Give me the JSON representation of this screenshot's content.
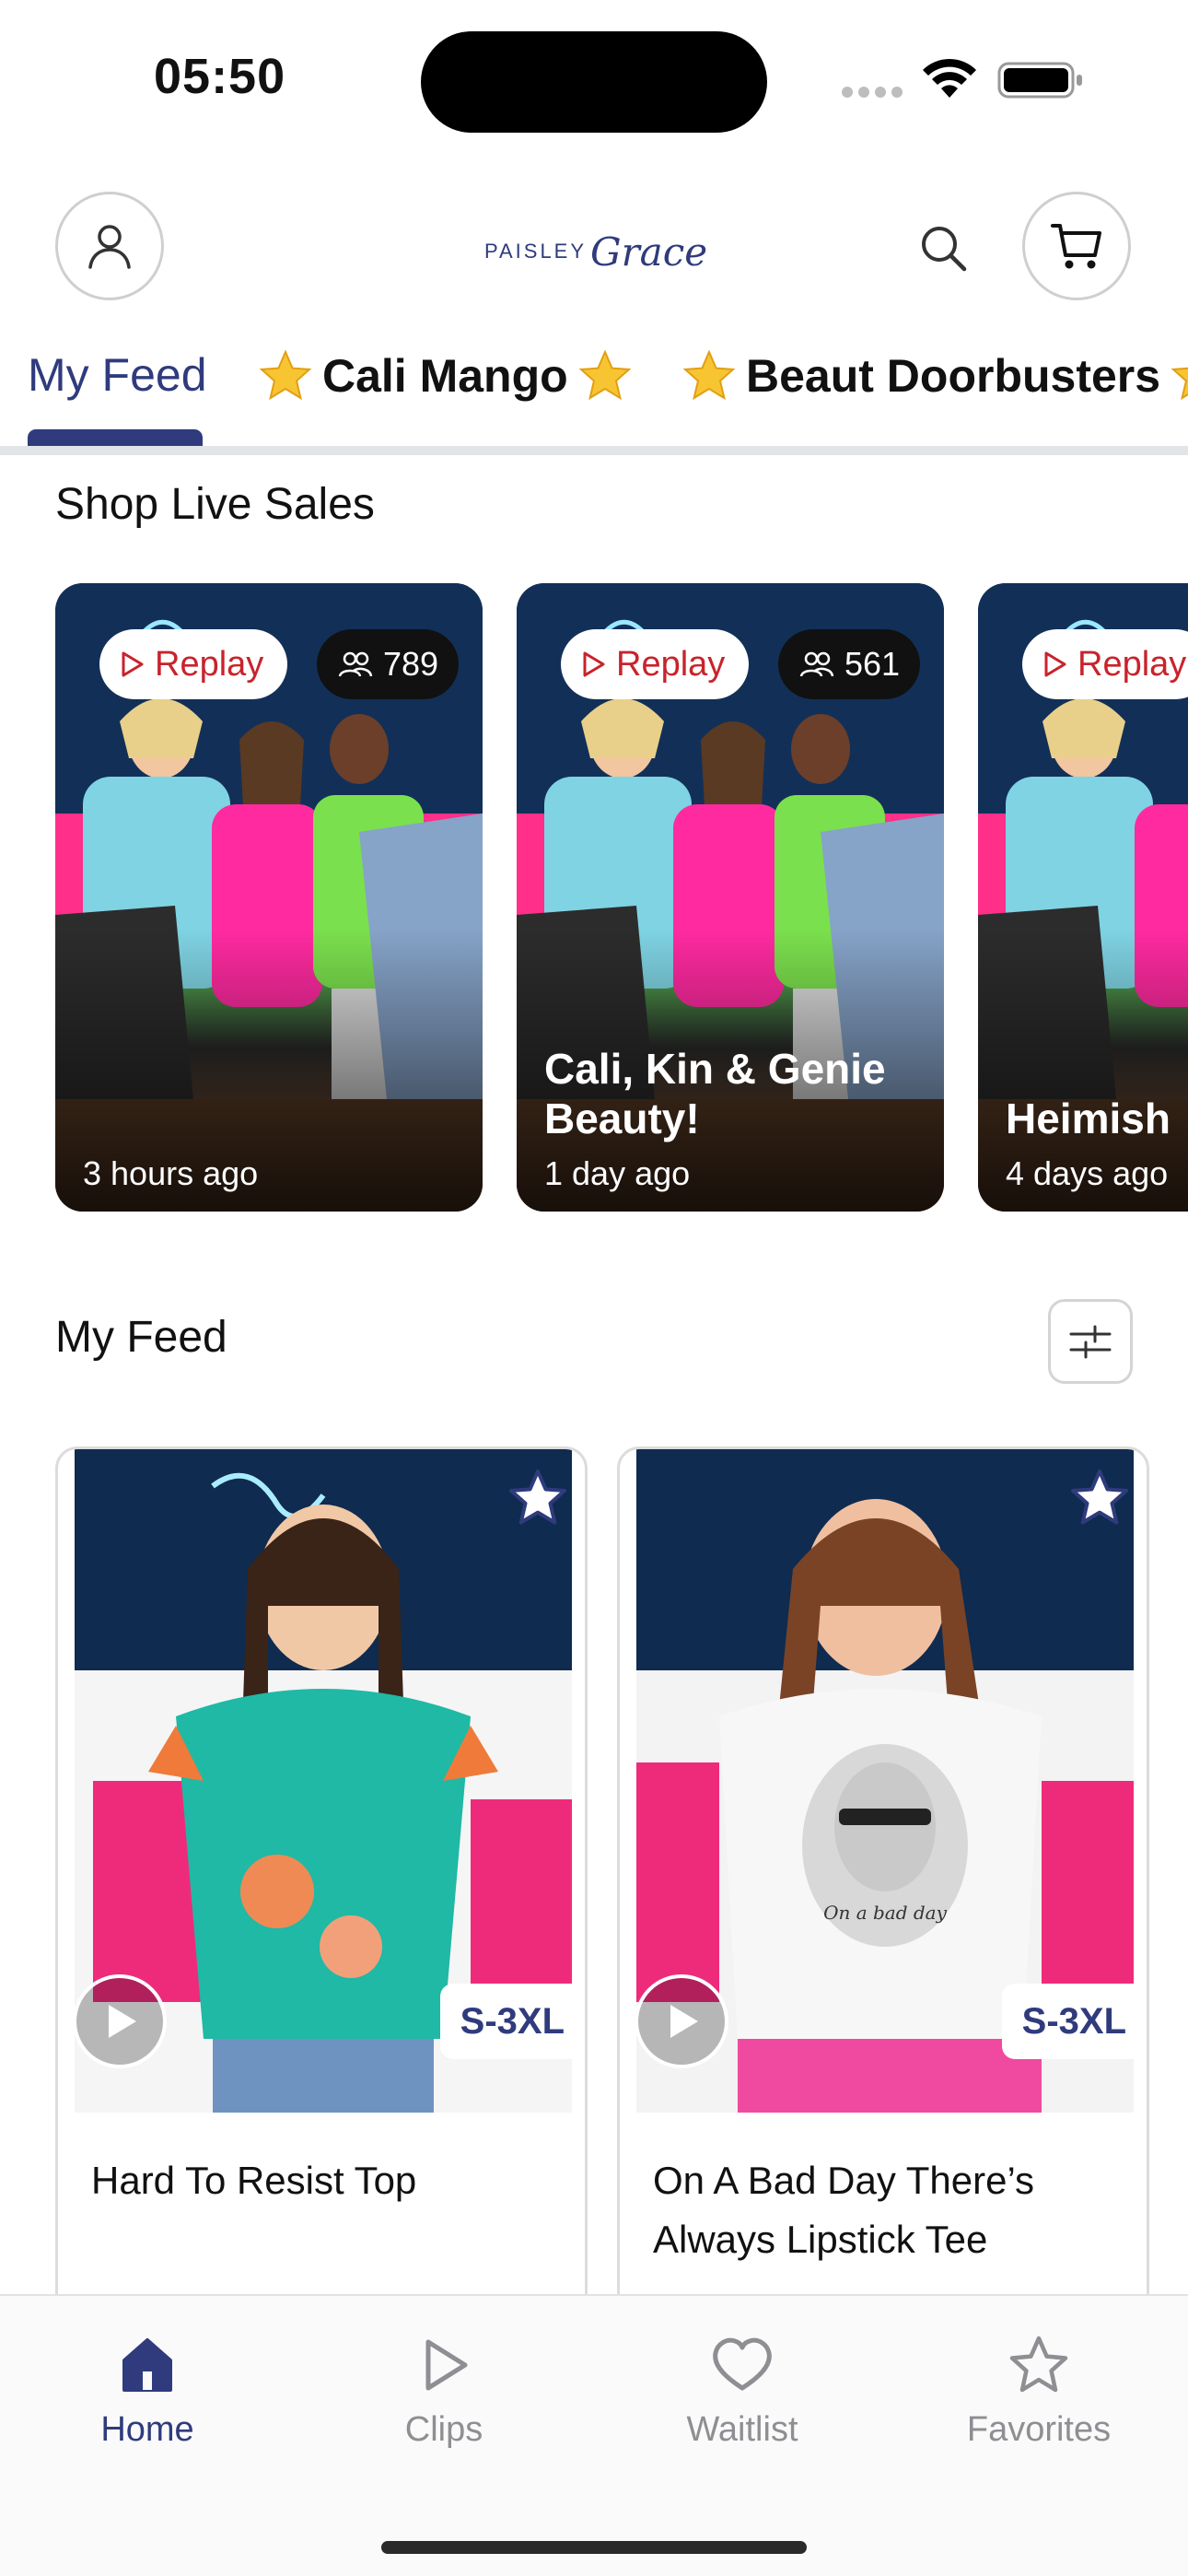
{
  "status_bar": {
    "time": "05:50"
  },
  "header": {
    "logo_text_a": "PAISLEY",
    "logo_text_b": "Grace"
  },
  "tabs": [
    {
      "label": "My Feed",
      "active": true
    },
    {
      "label": "Cali Mango",
      "active": false
    },
    {
      "label": "Beaut Doorbusters",
      "active": false
    }
  ],
  "live_section": {
    "title": "Shop Live Sales",
    "replay_label": "Replay",
    "cards": [
      {
        "name": "",
        "viewers": "789",
        "ago": "3 hours ago"
      },
      {
        "name": "Cali, Kin & Genie Beauty!",
        "viewers": "561",
        "ago": "1 day ago"
      },
      {
        "name": "Heimish",
        "viewers": "",
        "ago": "4 days ago"
      }
    ]
  },
  "feed_section": {
    "title": "My Feed",
    "products": [
      {
        "name": "Hard To Resist Top",
        "size": "S-3XL"
      },
      {
        "name": "On A Bad Day There’s Always Lipstick Tee",
        "size": "S-3XL"
      }
    ]
  },
  "bottom_nav": [
    {
      "label": "Home",
      "icon": "home-icon",
      "active": true
    },
    {
      "label": "Clips",
      "icon": "play-icon",
      "active": false
    },
    {
      "label": "Waitlist",
      "icon": "heart-icon",
      "active": false
    },
    {
      "label": "Favorites",
      "icon": "star-icon",
      "active": false
    }
  ],
  "colors": {
    "brand": "#2f3b7c",
    "replay_red": "#c8232c",
    "tab_divider": "#e3e4e8"
  }
}
